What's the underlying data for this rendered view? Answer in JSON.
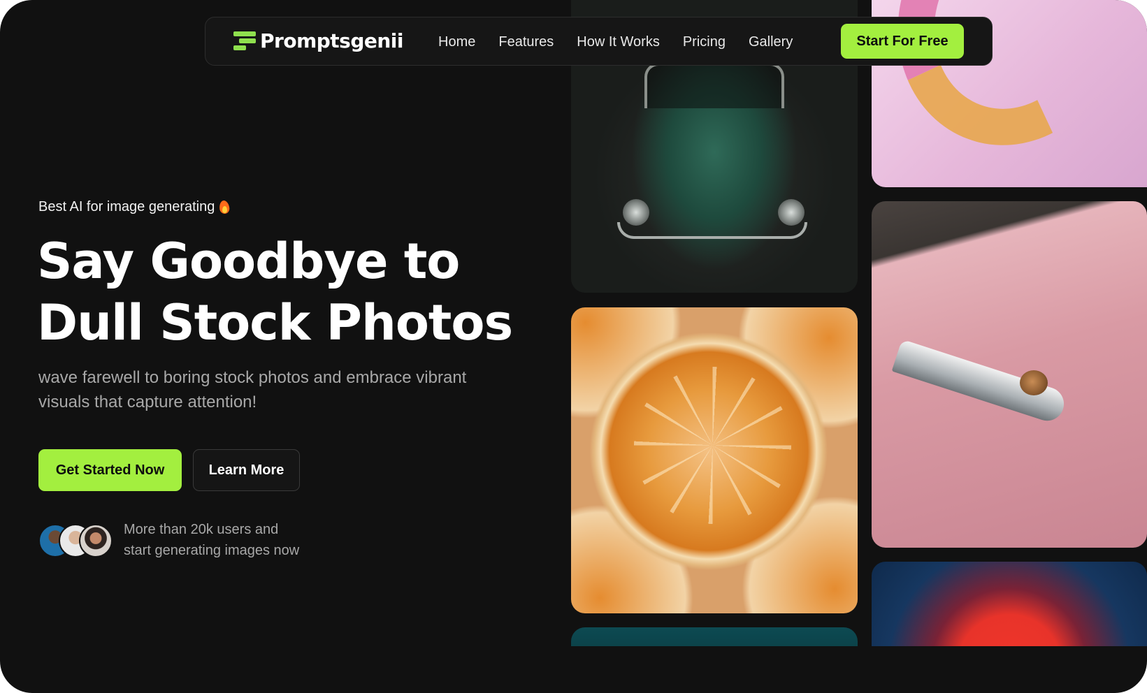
{
  "nav": {
    "brand": "Promptsgenii",
    "links": [
      "Home",
      "Features",
      "How It Works",
      "Pricing",
      "Gallery"
    ],
    "cta": "Start For Free"
  },
  "hero": {
    "eyebrow": "Best AI for image generating",
    "headline_line1": "Say Goodbye to",
    "headline_line2": "Dull Stock Photos",
    "subtext": "wave farewell to boring stock photos and embrace vibrant visuals that capture attention!",
    "primary_button": "Get Started Now",
    "secondary_button": "Learn More",
    "social_line1": "More than 20k users and",
    "social_line2": "start generating images now"
  },
  "colors": {
    "background": "#111111",
    "accent": "#a3ef3f",
    "text": "#ffffff",
    "muted_text": "#a8a8a8"
  },
  "icons": {
    "brand": "stacked-bars-logo-icon",
    "eyebrow": "fire-icon"
  }
}
